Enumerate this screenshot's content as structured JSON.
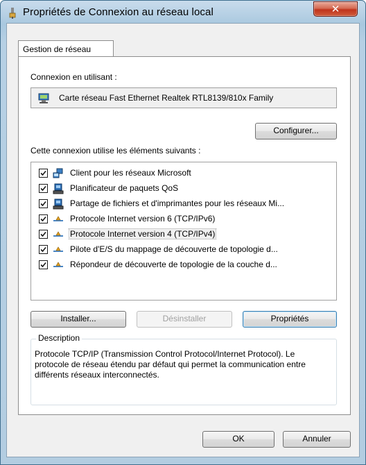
{
  "window": {
    "title": "Propriétés de Connexion au réseau local",
    "close_symbol": "✕"
  },
  "tabs": [
    {
      "label": "Gestion de réseau"
    }
  ],
  "connect_using": {
    "label": "Connexion en utilisant :",
    "adapter": "Carte réseau Fast Ethernet Realtek RTL8139/810x Family",
    "configure_button": "Configurer..."
  },
  "items_section": {
    "label": "Cette connexion utilise les éléments suivants :",
    "items": [
      {
        "label": "Client pour les réseaux Microsoft",
        "checked": true,
        "icon": "network-client-icon"
      },
      {
        "label": "Planificateur de paquets QoS",
        "checked": true,
        "icon": "service-icon"
      },
      {
        "label": "Partage de fichiers et d'imprimantes pour les réseaux Mi...",
        "checked": true,
        "icon": "service-icon"
      },
      {
        "label": "Protocole Internet version 6 (TCP/IPv6)",
        "checked": true,
        "icon": "protocol-icon"
      },
      {
        "label": "Protocole Internet version 4 (TCP/IPv4)",
        "checked": true,
        "icon": "protocol-icon",
        "selected": true
      },
      {
        "label": "Pilote d'E/S du mappage de découverte de topologie d...",
        "checked": true,
        "icon": "protocol-icon"
      },
      {
        "label": "Répondeur de découverte de topologie de la couche d...",
        "checked": true,
        "icon": "protocol-icon"
      }
    ]
  },
  "buttons": {
    "install": "Installer...",
    "uninstall": "Désinstaller",
    "properties": "Propriétés",
    "ok": "OK",
    "cancel": "Annuler"
  },
  "description": {
    "title": "Description",
    "text": "Protocole TCP/IP (Transmission Control Protocol/Internet Protocol). Le protocole de réseau étendu par défaut qui permet la communication entre différents réseaux interconnectés."
  }
}
